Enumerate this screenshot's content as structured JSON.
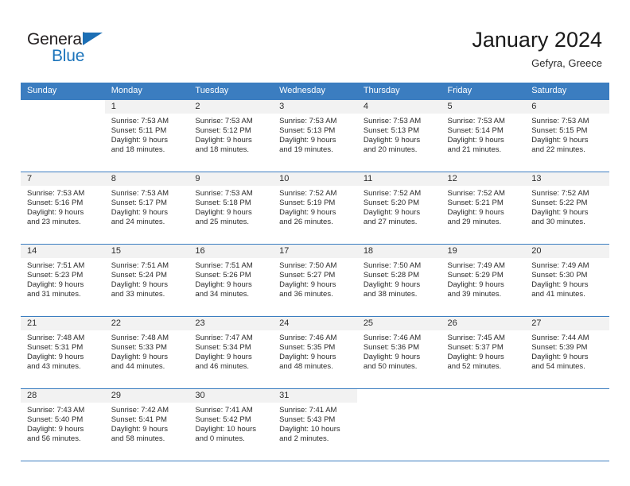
{
  "brand": {
    "name_part1": "General",
    "name_part2": "Blue",
    "triangle_icon": "triangle-icon",
    "accent_color": "#1c74bb",
    "header_color": "#3b7dc0"
  },
  "header": {
    "title": "January 2024",
    "subtitle": "Gefyra, Greece"
  },
  "weekdays": [
    "Sunday",
    "Monday",
    "Tuesday",
    "Wednesday",
    "Thursday",
    "Friday",
    "Saturday"
  ],
  "weeks": [
    [
      {
        "day": "",
        "sunrise": "",
        "sunset": "",
        "daylight1": "",
        "daylight2": ""
      },
      {
        "day": "1",
        "sunrise": "Sunrise: 7:53 AM",
        "sunset": "Sunset: 5:11 PM",
        "daylight1": "Daylight: 9 hours",
        "daylight2": "and 18 minutes."
      },
      {
        "day": "2",
        "sunrise": "Sunrise: 7:53 AM",
        "sunset": "Sunset: 5:12 PM",
        "daylight1": "Daylight: 9 hours",
        "daylight2": "and 18 minutes."
      },
      {
        "day": "3",
        "sunrise": "Sunrise: 7:53 AM",
        "sunset": "Sunset: 5:13 PM",
        "daylight1": "Daylight: 9 hours",
        "daylight2": "and 19 minutes."
      },
      {
        "day": "4",
        "sunrise": "Sunrise: 7:53 AM",
        "sunset": "Sunset: 5:13 PM",
        "daylight1": "Daylight: 9 hours",
        "daylight2": "and 20 minutes."
      },
      {
        "day": "5",
        "sunrise": "Sunrise: 7:53 AM",
        "sunset": "Sunset: 5:14 PM",
        "daylight1": "Daylight: 9 hours",
        "daylight2": "and 21 minutes."
      },
      {
        "day": "6",
        "sunrise": "Sunrise: 7:53 AM",
        "sunset": "Sunset: 5:15 PM",
        "daylight1": "Daylight: 9 hours",
        "daylight2": "and 22 minutes."
      }
    ],
    [
      {
        "day": "7",
        "sunrise": "Sunrise: 7:53 AM",
        "sunset": "Sunset: 5:16 PM",
        "daylight1": "Daylight: 9 hours",
        "daylight2": "and 23 minutes."
      },
      {
        "day": "8",
        "sunrise": "Sunrise: 7:53 AM",
        "sunset": "Sunset: 5:17 PM",
        "daylight1": "Daylight: 9 hours",
        "daylight2": "and 24 minutes."
      },
      {
        "day": "9",
        "sunrise": "Sunrise: 7:53 AM",
        "sunset": "Sunset: 5:18 PM",
        "daylight1": "Daylight: 9 hours",
        "daylight2": "and 25 minutes."
      },
      {
        "day": "10",
        "sunrise": "Sunrise: 7:52 AM",
        "sunset": "Sunset: 5:19 PM",
        "daylight1": "Daylight: 9 hours",
        "daylight2": "and 26 minutes."
      },
      {
        "day": "11",
        "sunrise": "Sunrise: 7:52 AM",
        "sunset": "Sunset: 5:20 PM",
        "daylight1": "Daylight: 9 hours",
        "daylight2": "and 27 minutes."
      },
      {
        "day": "12",
        "sunrise": "Sunrise: 7:52 AM",
        "sunset": "Sunset: 5:21 PM",
        "daylight1": "Daylight: 9 hours",
        "daylight2": "and 29 minutes."
      },
      {
        "day": "13",
        "sunrise": "Sunrise: 7:52 AM",
        "sunset": "Sunset: 5:22 PM",
        "daylight1": "Daylight: 9 hours",
        "daylight2": "and 30 minutes."
      }
    ],
    [
      {
        "day": "14",
        "sunrise": "Sunrise: 7:51 AM",
        "sunset": "Sunset: 5:23 PM",
        "daylight1": "Daylight: 9 hours",
        "daylight2": "and 31 minutes."
      },
      {
        "day": "15",
        "sunrise": "Sunrise: 7:51 AM",
        "sunset": "Sunset: 5:24 PM",
        "daylight1": "Daylight: 9 hours",
        "daylight2": "and 33 minutes."
      },
      {
        "day": "16",
        "sunrise": "Sunrise: 7:51 AM",
        "sunset": "Sunset: 5:26 PM",
        "daylight1": "Daylight: 9 hours",
        "daylight2": "and 34 minutes."
      },
      {
        "day": "17",
        "sunrise": "Sunrise: 7:50 AM",
        "sunset": "Sunset: 5:27 PM",
        "daylight1": "Daylight: 9 hours",
        "daylight2": "and 36 minutes."
      },
      {
        "day": "18",
        "sunrise": "Sunrise: 7:50 AM",
        "sunset": "Sunset: 5:28 PM",
        "daylight1": "Daylight: 9 hours",
        "daylight2": "and 38 minutes."
      },
      {
        "day": "19",
        "sunrise": "Sunrise: 7:49 AM",
        "sunset": "Sunset: 5:29 PM",
        "daylight1": "Daylight: 9 hours",
        "daylight2": "and 39 minutes."
      },
      {
        "day": "20",
        "sunrise": "Sunrise: 7:49 AM",
        "sunset": "Sunset: 5:30 PM",
        "daylight1": "Daylight: 9 hours",
        "daylight2": "and 41 minutes."
      }
    ],
    [
      {
        "day": "21",
        "sunrise": "Sunrise: 7:48 AM",
        "sunset": "Sunset: 5:31 PM",
        "daylight1": "Daylight: 9 hours",
        "daylight2": "and 43 minutes."
      },
      {
        "day": "22",
        "sunrise": "Sunrise: 7:48 AM",
        "sunset": "Sunset: 5:33 PM",
        "daylight1": "Daylight: 9 hours",
        "daylight2": "and 44 minutes."
      },
      {
        "day": "23",
        "sunrise": "Sunrise: 7:47 AM",
        "sunset": "Sunset: 5:34 PM",
        "daylight1": "Daylight: 9 hours",
        "daylight2": "and 46 minutes."
      },
      {
        "day": "24",
        "sunrise": "Sunrise: 7:46 AM",
        "sunset": "Sunset: 5:35 PM",
        "daylight1": "Daylight: 9 hours",
        "daylight2": "and 48 minutes."
      },
      {
        "day": "25",
        "sunrise": "Sunrise: 7:46 AM",
        "sunset": "Sunset: 5:36 PM",
        "daylight1": "Daylight: 9 hours",
        "daylight2": "and 50 minutes."
      },
      {
        "day": "26",
        "sunrise": "Sunrise: 7:45 AM",
        "sunset": "Sunset: 5:37 PM",
        "daylight1": "Daylight: 9 hours",
        "daylight2": "and 52 minutes."
      },
      {
        "day": "27",
        "sunrise": "Sunrise: 7:44 AM",
        "sunset": "Sunset: 5:39 PM",
        "daylight1": "Daylight: 9 hours",
        "daylight2": "and 54 minutes."
      }
    ],
    [
      {
        "day": "28",
        "sunrise": "Sunrise: 7:43 AM",
        "sunset": "Sunset: 5:40 PM",
        "daylight1": "Daylight: 9 hours",
        "daylight2": "and 56 minutes."
      },
      {
        "day": "29",
        "sunrise": "Sunrise: 7:42 AM",
        "sunset": "Sunset: 5:41 PM",
        "daylight1": "Daylight: 9 hours",
        "daylight2": "and 58 minutes."
      },
      {
        "day": "30",
        "sunrise": "Sunrise: 7:41 AM",
        "sunset": "Sunset: 5:42 PM",
        "daylight1": "Daylight: 10 hours",
        "daylight2": "and 0 minutes."
      },
      {
        "day": "31",
        "sunrise": "Sunrise: 7:41 AM",
        "sunset": "Sunset: 5:43 PM",
        "daylight1": "Daylight: 10 hours",
        "daylight2": "and 2 minutes."
      },
      {
        "day": "",
        "sunrise": "",
        "sunset": "",
        "daylight1": "",
        "daylight2": ""
      },
      {
        "day": "",
        "sunrise": "",
        "sunset": "",
        "daylight1": "",
        "daylight2": ""
      },
      {
        "day": "",
        "sunrise": "",
        "sunset": "",
        "daylight1": "",
        "daylight2": ""
      }
    ]
  ]
}
